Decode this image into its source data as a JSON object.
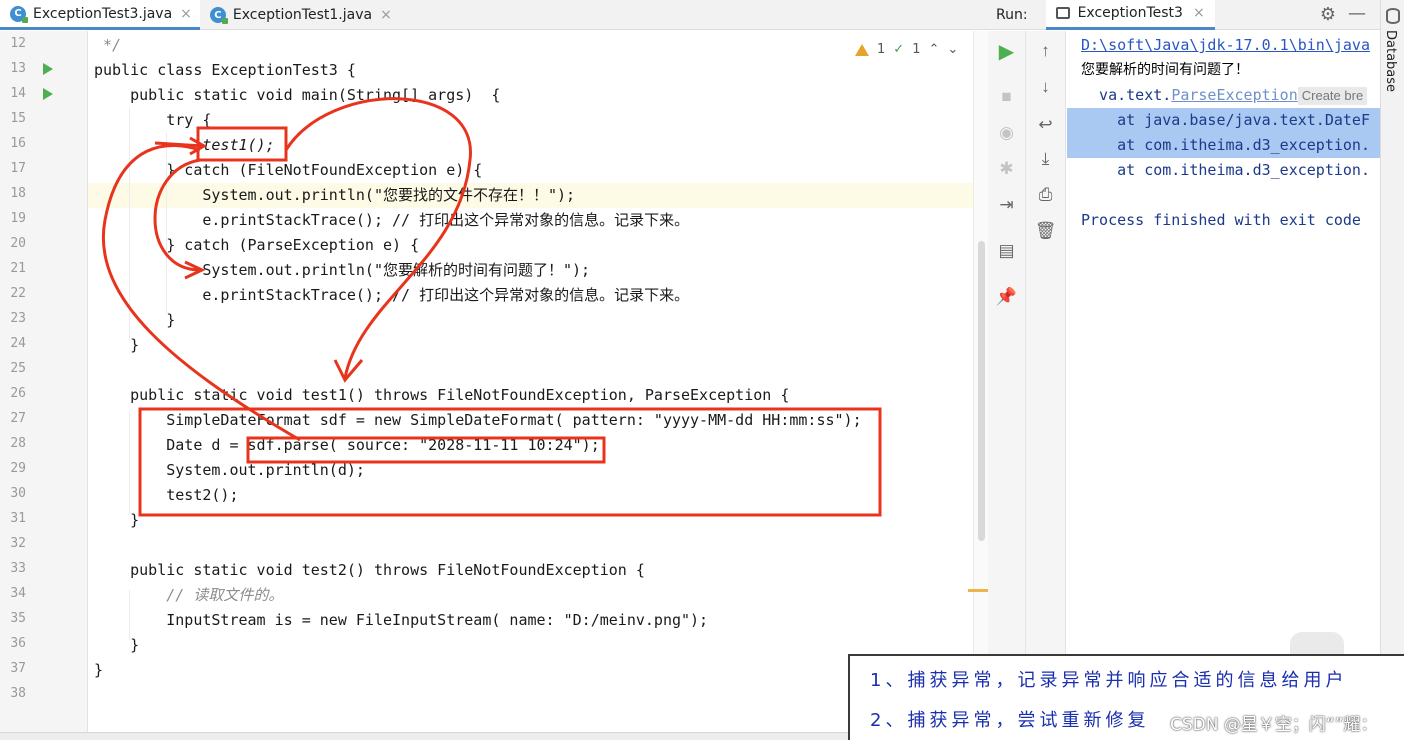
{
  "editor_tabs": [
    {
      "label": "ExceptionTest3.java",
      "active": true
    },
    {
      "label": "ExceptionTest1.java",
      "active": false
    }
  ],
  "inspections": {
    "warnings": "1",
    "typos": "1"
  },
  "code_lines": [
    {
      "n": "12",
      "text": " */"
    },
    {
      "n": "13",
      "text": "public class ExceptionTest3 {"
    },
    {
      "n": "14",
      "text": "    public static void main(String[] args)  {"
    },
    {
      "n": "15",
      "text": "        try {"
    },
    {
      "n": "16",
      "text": "            test1();"
    },
    {
      "n": "17",
      "text": "        } catch (FileNotFoundException e) {"
    },
    {
      "n": "18",
      "text": "            System.out.println(\"您要找的文件不存在！！\");"
    },
    {
      "n": "19",
      "text": "            e.printStackTrace(); // 打印出这个异常对象的信息。记录下来。"
    },
    {
      "n": "20",
      "text": "        } catch (ParseException e) {"
    },
    {
      "n": "21",
      "text": "            System.out.println(\"您要解析的时间有问题了！\");"
    },
    {
      "n": "22",
      "text": "            e.printStackTrace(); // 打印出这个异常对象的信息。记录下来。"
    },
    {
      "n": "23",
      "text": "        }"
    },
    {
      "n": "24",
      "text": "    }"
    },
    {
      "n": "25",
      "text": ""
    },
    {
      "n": "26",
      "text": "    public static void test1() throws FileNotFoundException, ParseException {"
    },
    {
      "n": "27",
      "text": "        SimpleDateFormat sdf = new SimpleDateFormat( pattern: \"yyyy-MM-dd HH:mm:ss\");"
    },
    {
      "n": "28",
      "text": "        Date d = sdf.parse( source: \"2028-11-11 10:24\");"
    },
    {
      "n": "29",
      "text": "        System.out.println(d);"
    },
    {
      "n": "30",
      "text": "        test2();"
    },
    {
      "n": "31",
      "text": "    }"
    },
    {
      "n": "32",
      "text": ""
    },
    {
      "n": "33",
      "text": "    public static void test2() throws FileNotFoundException {"
    },
    {
      "n": "34",
      "text": "        // 读取文件的。"
    },
    {
      "n": "35",
      "text": "        InputStream is = new FileInputStream( name: \"D:/meinv.png\");"
    },
    {
      "n": "36",
      "text": "    }"
    },
    {
      "n": "37",
      "text": "}"
    },
    {
      "n": "38",
      "text": ""
    }
  ],
  "run_panel": {
    "label": "Run:",
    "tab": "ExceptionTest3",
    "console": {
      "cmd": "D:\\soft\\Java\\jdk-17.0.1\\bin\\java",
      "msg": "您要解析的时间有问题了！",
      "exc_prefix": "java.text.",
      "exc_name": "ParseException",
      "create_breakpoint": "Create bre",
      "trace1": "    at java.base/java.text.DateF",
      "trace2": "    at com.itheima.d3_exception.",
      "trace3": "    at com.itheima.d3_exception.",
      "finished": "Process finished with exit code"
    }
  },
  "side_label": "Database",
  "annotation": {
    "line1": "1、捕获异常，记录异常并响应合适的信息给用户",
    "line2": "2、捕获异常，尝试重新修复"
  },
  "watermark": "CSDN @星￥空；闪“”耀："
}
